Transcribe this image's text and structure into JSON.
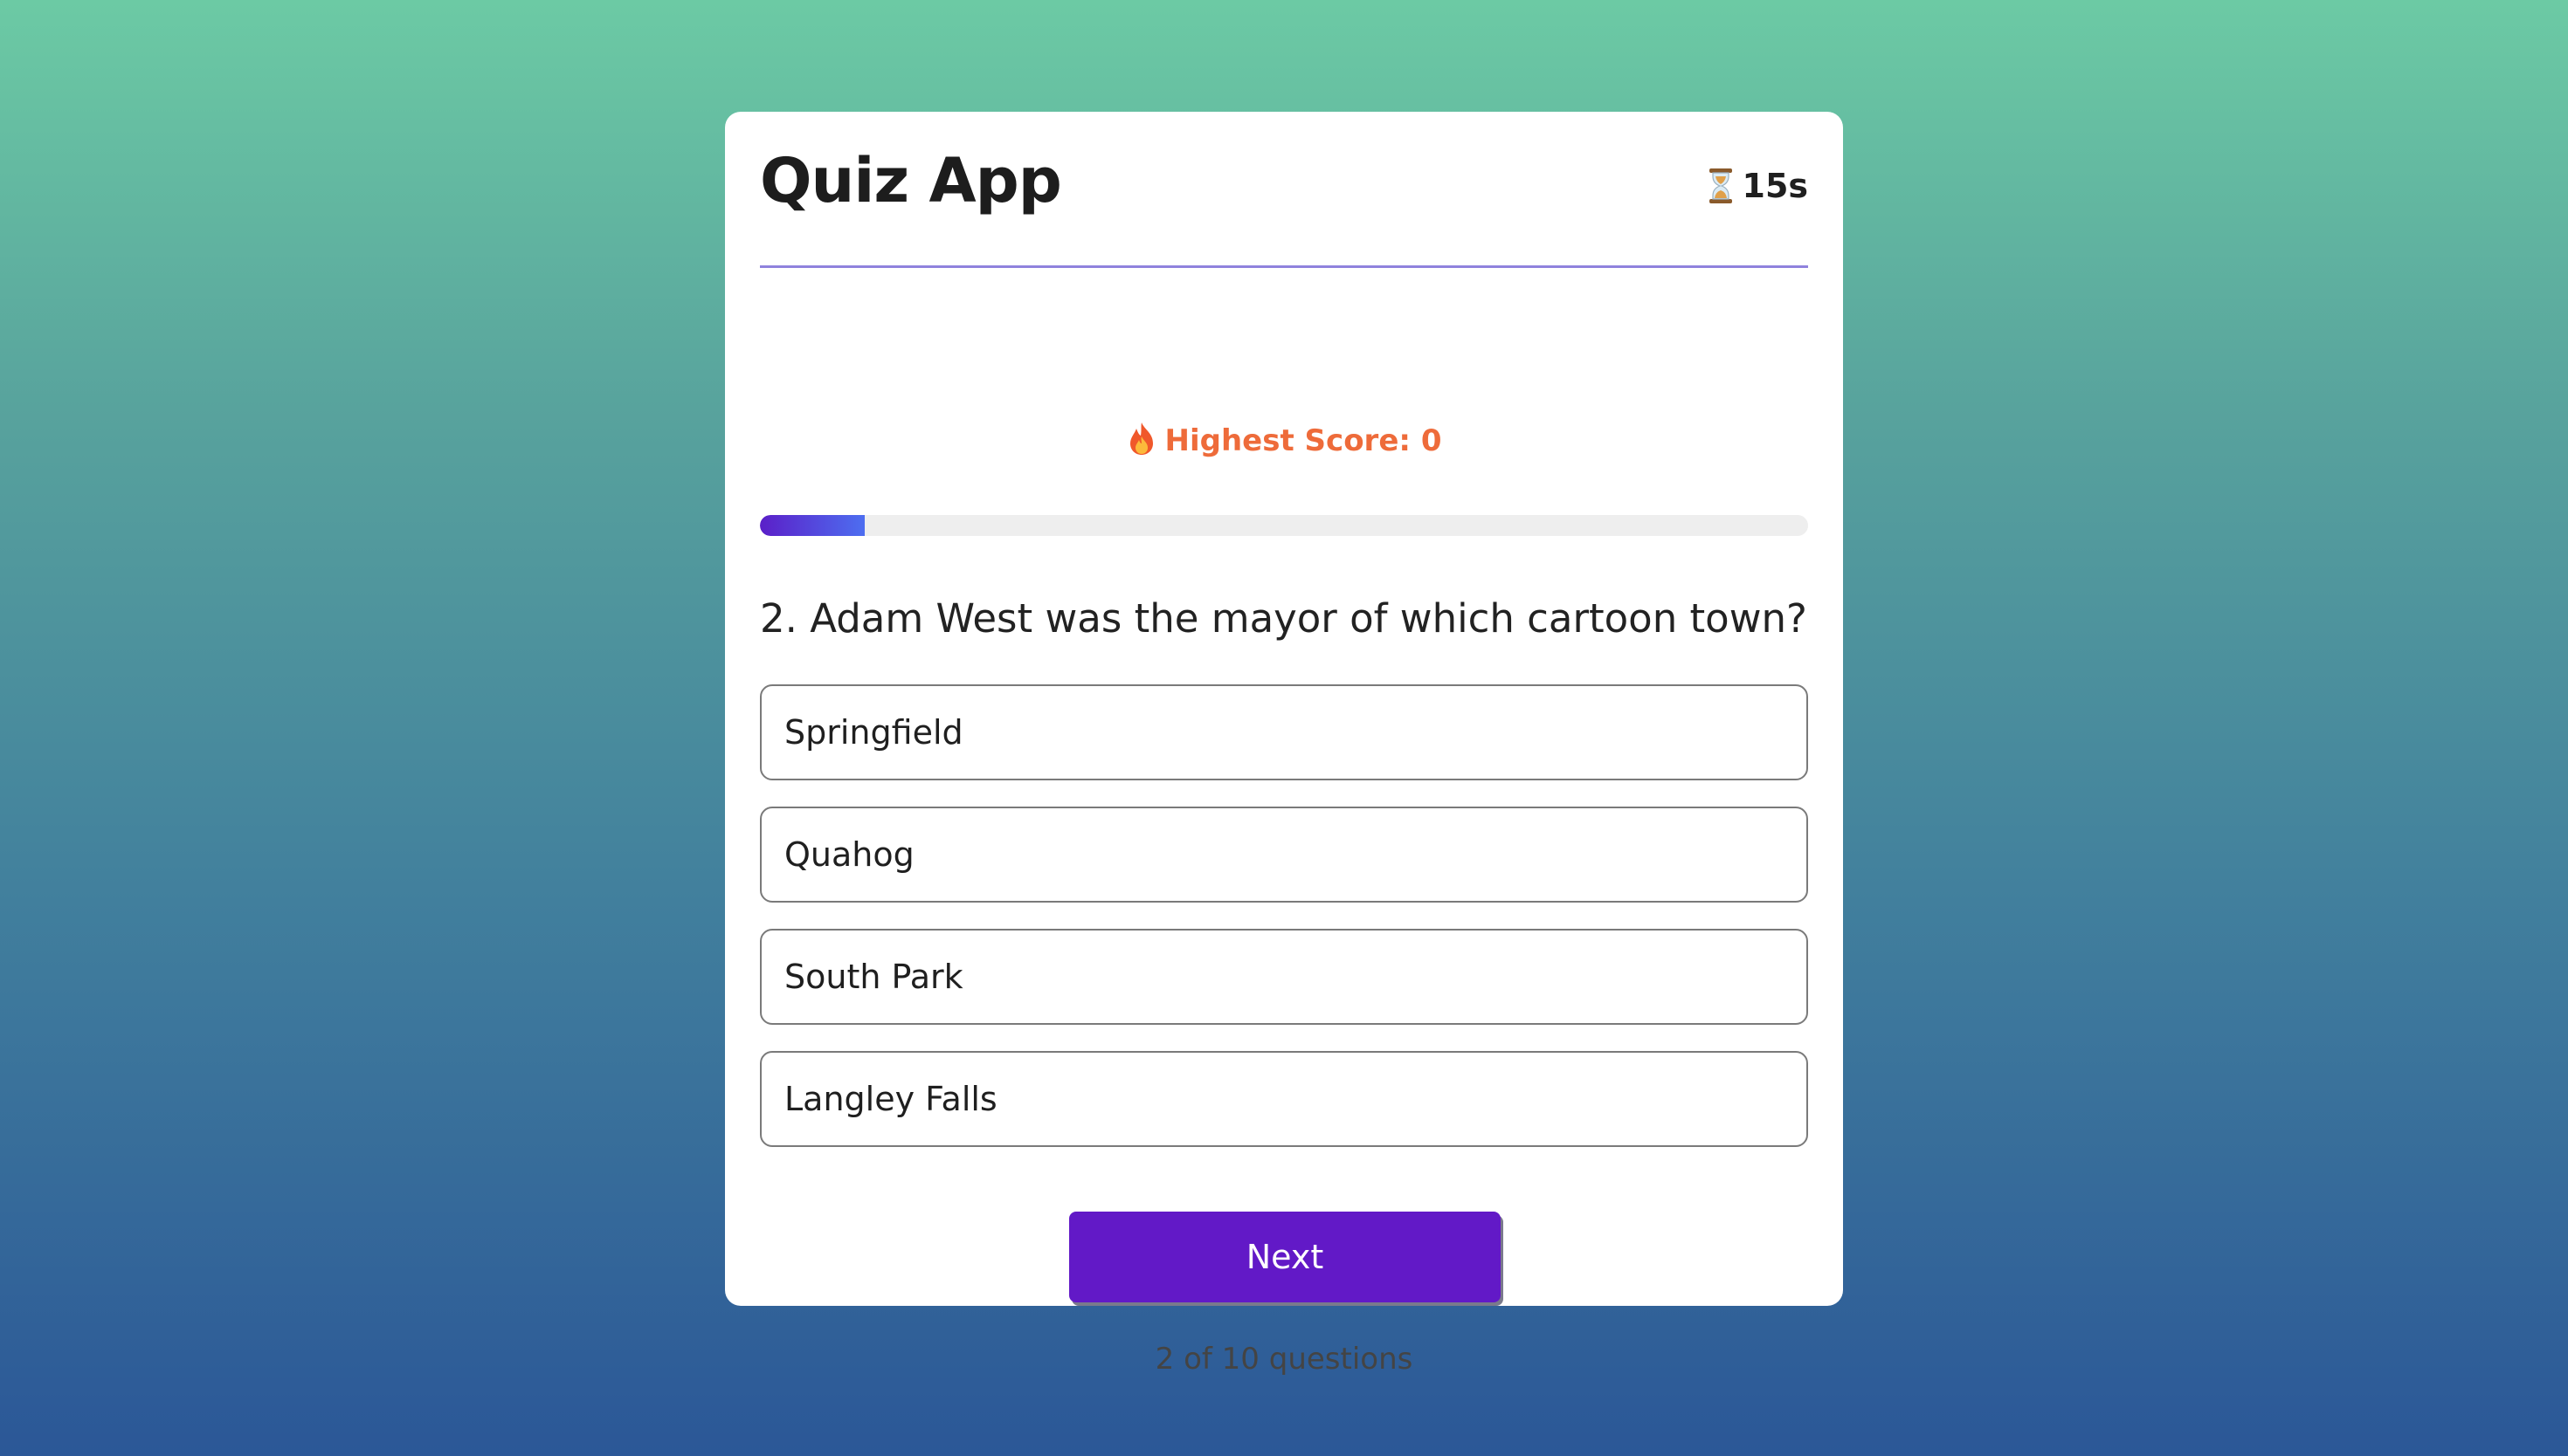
{
  "app": {
    "title": "Quiz App"
  },
  "timer": {
    "icon": "hourglass-icon",
    "value": "15s"
  },
  "score": {
    "icon": "flame-icon",
    "label": "Highest Score: 0",
    "color": "#ee6b3a"
  },
  "progress": {
    "fraction": 0.1,
    "fill_colors": [
      "#5b1fc8",
      "#4d6ef0"
    ]
  },
  "question": {
    "text": "2. Adam West was the mayor of which cartoon town?",
    "options": [
      {
        "label": "Springfield"
      },
      {
        "label": "Quahog"
      },
      {
        "label": "South Park"
      },
      {
        "label": "Langley Falls"
      }
    ]
  },
  "controls": {
    "next_label": "Next",
    "next_color": "#6219c7"
  },
  "footer": {
    "counter": "2 of 10 questions"
  },
  "colors": {
    "background_top": "#6ccaa4",
    "background_bottom": "#2b5797",
    "header_divider": "#8f82dd"
  }
}
